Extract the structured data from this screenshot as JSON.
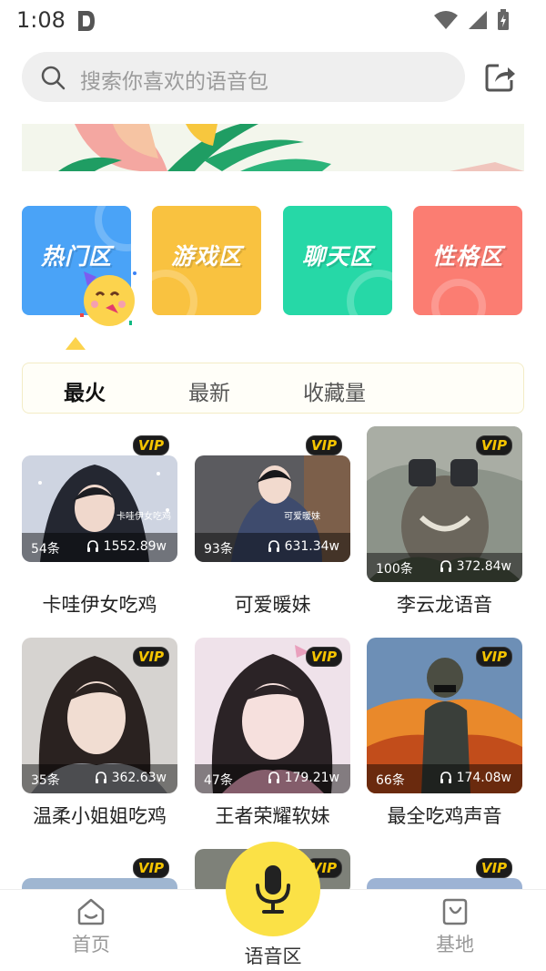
{
  "status": {
    "time": "1:08"
  },
  "search": {
    "placeholder": "搜索你喜欢的语音包"
  },
  "categories": [
    {
      "label": "热门区",
      "color": "#4aa3f7"
    },
    {
      "label": "游戏区",
      "color": "#f9c240"
    },
    {
      "label": "聊天区",
      "color": "#26d8a7"
    },
    {
      "label": "性格区",
      "color": "#fb7d72"
    }
  ],
  "tabs": [
    "最火",
    "最新",
    "收藏量"
  ],
  "vip_label": "VIP",
  "cards": [
    {
      "title": "卡哇伊女吃鸡",
      "count": "54条",
      "plays": "1552.89w",
      "overlay": "卡哇伊女吃鸡"
    },
    {
      "title": "可爱暖妹",
      "count": "93条",
      "plays": "631.34w",
      "overlay": "可爱暖妹"
    },
    {
      "title": "李云龙语音",
      "count": "100条",
      "plays": "372.84w"
    },
    {
      "title": "温柔小姐姐吃鸡",
      "count": "35条",
      "plays": "362.63w"
    },
    {
      "title": "王者荣耀软妹",
      "count": "47条",
      "plays": "179.21w"
    },
    {
      "title": "最全吃鸡声音",
      "count": "66条",
      "plays": "174.08w"
    }
  ],
  "nav": {
    "home": "首页",
    "voice": "语音区",
    "base": "基地"
  }
}
